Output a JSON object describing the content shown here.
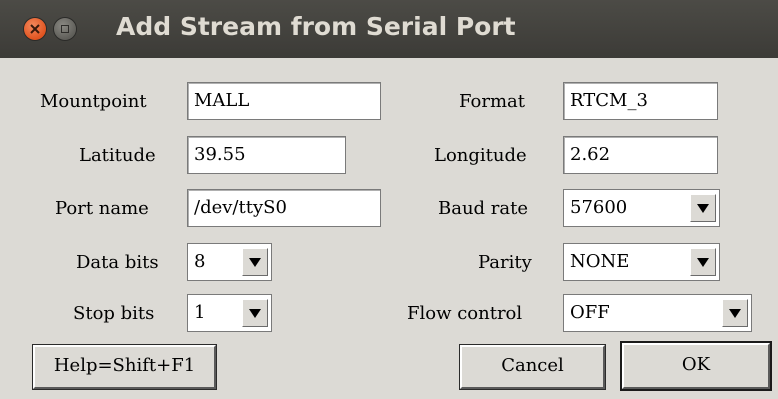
{
  "window": {
    "title": "Add Stream from Serial Port"
  },
  "fields": {
    "mountpoint": {
      "label": "Mountpoint",
      "value": "MALL"
    },
    "format": {
      "label": "Format",
      "value": "RTCM_3"
    },
    "latitude": {
      "label": "Latitude",
      "value": "39.55"
    },
    "longitude": {
      "label": "Longitude",
      "value": "2.62"
    },
    "port_name": {
      "label": "Port name",
      "value": "/dev/ttyS0"
    },
    "baud_rate": {
      "label": "Baud rate",
      "value": "57600"
    },
    "data_bits": {
      "label": "Data bits",
      "value": "8"
    },
    "parity": {
      "label": "Parity",
      "value": "NONE"
    },
    "stop_bits": {
      "label": "Stop bits",
      "value": "1"
    },
    "flow_control": {
      "label": "Flow control",
      "value": "OFF"
    }
  },
  "buttons": {
    "help": "Help=Shift+F1",
    "cancel": "Cancel",
    "ok": "OK"
  },
  "icons": {
    "close": "close-icon",
    "minimize": "minimize-icon",
    "dropdown": "chevron-down-icon"
  }
}
